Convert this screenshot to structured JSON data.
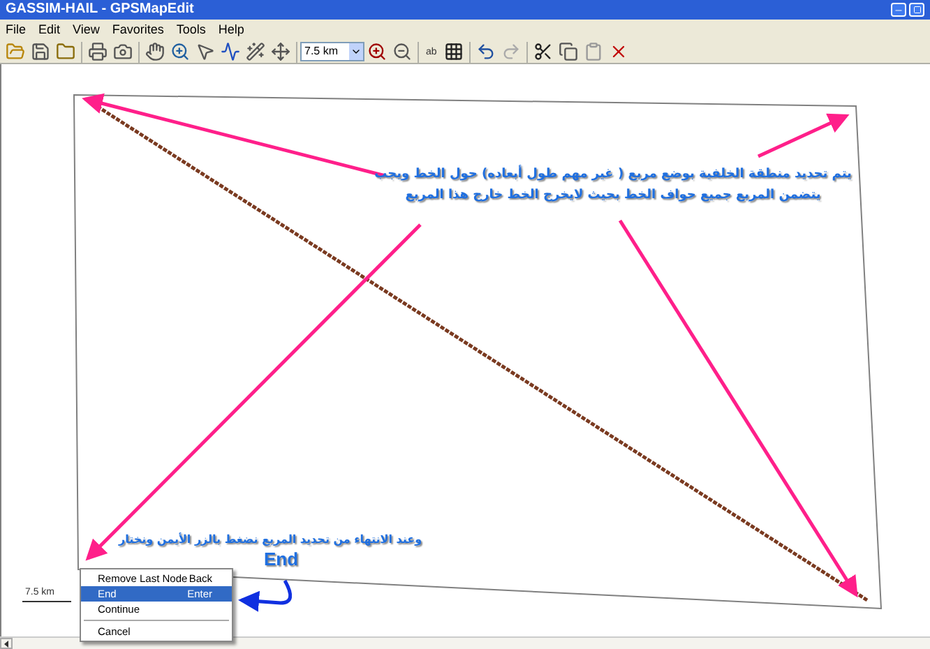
{
  "window": {
    "title": "GASSIM-HAIL - GPSMapEdit"
  },
  "menu": [
    "File",
    "Edit",
    "View",
    "Favorites",
    "Tools",
    "Help"
  ],
  "toolbar": {
    "scale_select": "7.5 km",
    "label_tool": "ab"
  },
  "annotations": [
    {
      "kind": "note",
      "text": "يتم تحديد منطقة الخلفية بوضع مربع ( غير مهم طول أبعاده) حول الخط ويجب يتضمن المربع جميع حواف الخط بحيث لايخرج الخط خارج هذا المربع"
    },
    {
      "kind": "note2",
      "text": "وعند الانتهاء من تحديد المربع نضغط بالزر الأيمن ونختار"
    },
    {
      "kind": "keyword",
      "text": "End"
    }
  ],
  "scale_bar": "7.5 km",
  "context_menu": [
    {
      "label": "Remove Last Node",
      "shortcut": "Back",
      "selected": false
    },
    {
      "label": "End",
      "shortcut": "Enter",
      "selected": true
    },
    {
      "label": "Continue",
      "selected": false
    },
    {
      "label": "Cancel",
      "selected": false,
      "separator_before": true
    }
  ]
}
